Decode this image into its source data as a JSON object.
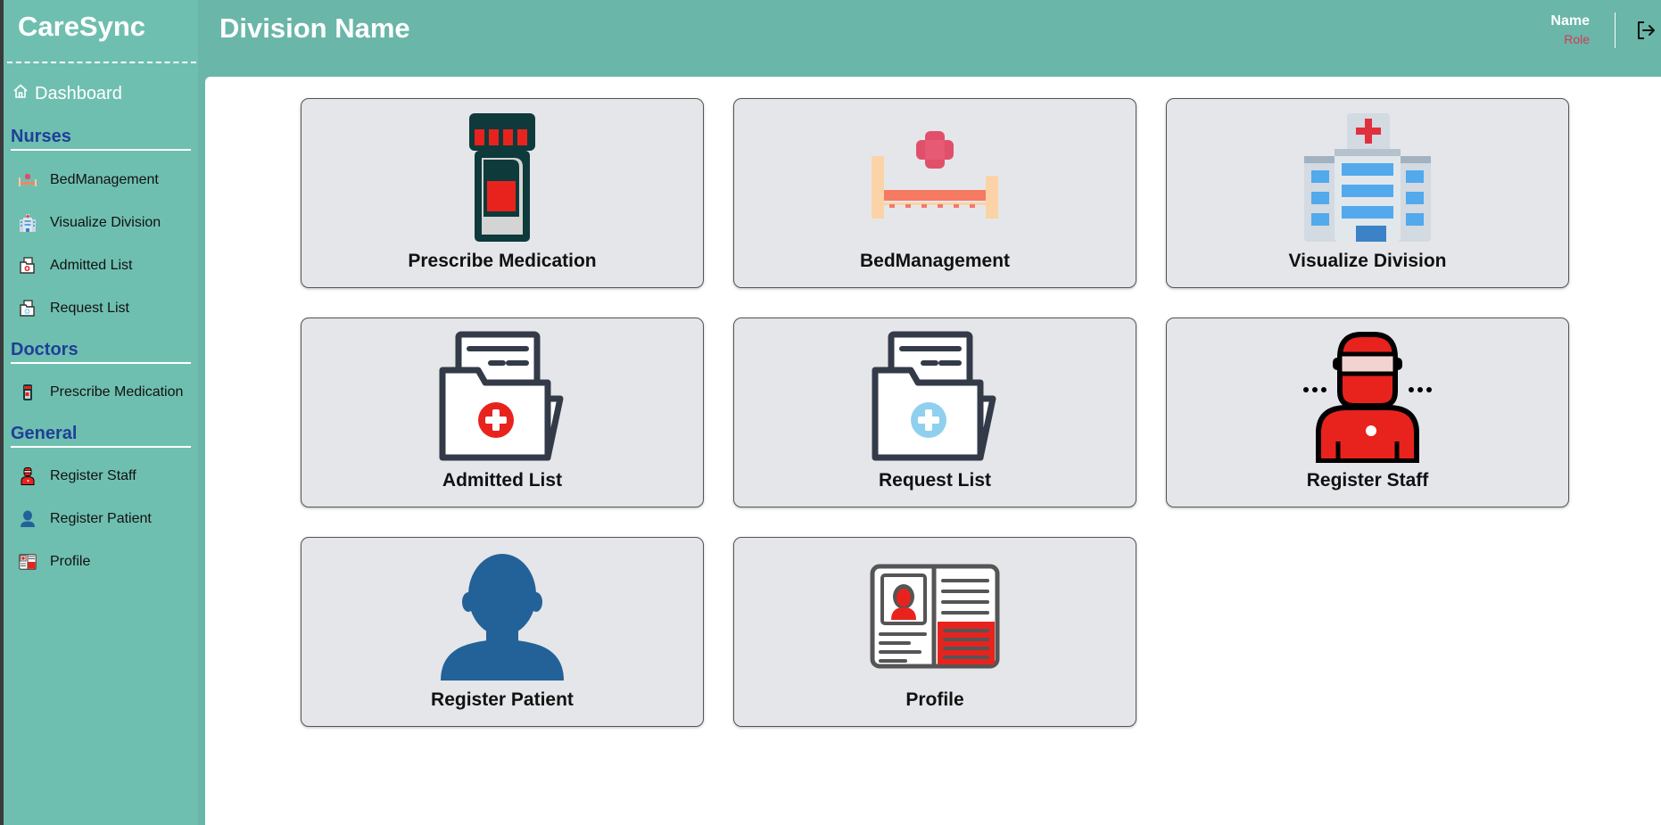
{
  "app": {
    "brand": "CareSync"
  },
  "header": {
    "title": "Division Name",
    "user_name": "Name",
    "user_role": "Role"
  },
  "sidebar": {
    "dashboard": "Dashboard",
    "sections": [
      {
        "title": "Nurses",
        "items": [
          "BedManagement",
          "Visualize Division",
          "Admitted List",
          "Request List"
        ]
      },
      {
        "title": "Doctors",
        "items": [
          "Prescribe Medication"
        ]
      },
      {
        "title": "General",
        "items": [
          "Register Staff",
          "Register Patient",
          "Profile"
        ]
      }
    ]
  },
  "cards": [
    {
      "label": "Prescribe Medication",
      "icon": "medicine-bottle-icon"
    },
    {
      "label": "BedManagement",
      "icon": "hospital-bed-icon"
    },
    {
      "label": "Visualize Division",
      "icon": "hospital-building-icon"
    },
    {
      "label": "Admitted List",
      "icon": "medical-folder-red-icon"
    },
    {
      "label": "Request List",
      "icon": "medical-folder-blue-icon"
    },
    {
      "label": "Register Staff",
      "icon": "surgeon-icon"
    },
    {
      "label": "Register Patient",
      "icon": "user-silhouette-icon"
    },
    {
      "label": "Profile",
      "icon": "id-card-icon"
    }
  ],
  "colors": {
    "header_bg": "#6ab6a8",
    "sidebar_bg": "#6fbfb0",
    "section_title": "#1f3f97",
    "role_text": "#d23a55",
    "card_bg": "#e5e6ea"
  }
}
